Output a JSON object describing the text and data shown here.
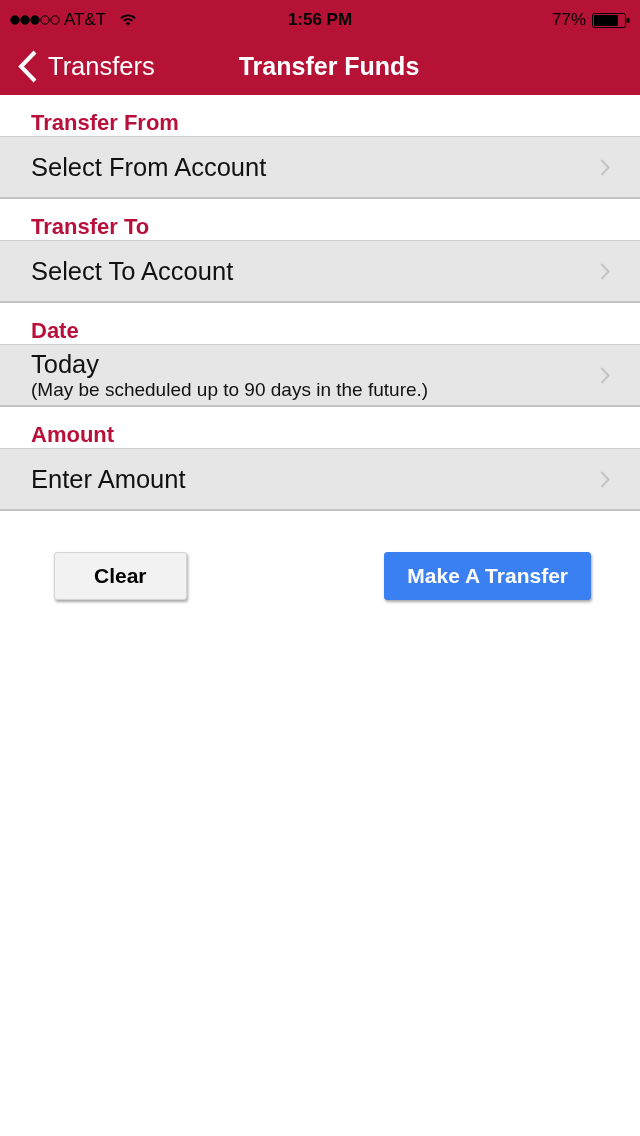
{
  "status_bar": {
    "carrier": "AT&T",
    "time": "1:56 PM",
    "battery": "77%"
  },
  "nav_bar": {
    "back": "Transfers",
    "title": "Transfer Funds"
  },
  "sections": [
    {
      "heading": "Transfer From",
      "value": "Select From Account"
    },
    {
      "heading": "Transfer To",
      "value": "Select To Account"
    },
    {
      "heading": "Date",
      "value": "Today",
      "note": "(May be scheduled up to 90 days in the future.)"
    },
    {
      "heading": "Amount",
      "value": "Enter Amount"
    }
  ],
  "buttons": [
    {
      "label": "Clear",
      "kind": "secondary"
    },
    {
      "label": "Make A Transfer",
      "kind": "primary"
    }
  ]
}
